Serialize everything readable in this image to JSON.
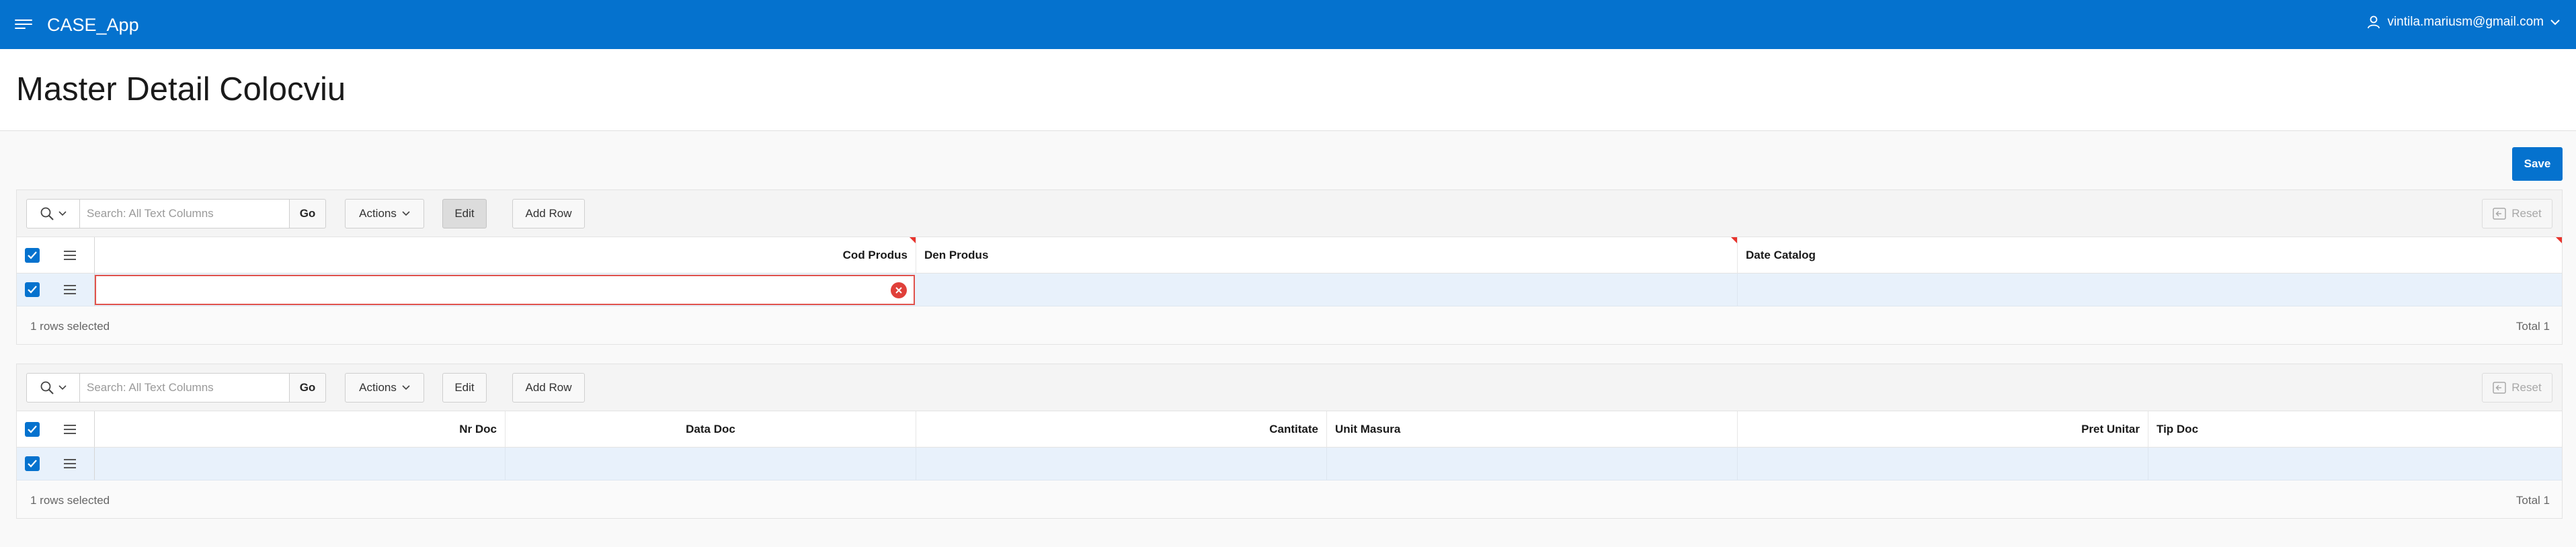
{
  "header": {
    "app_title": "CASE_App",
    "user": "vintila.mariusm@gmail.com"
  },
  "page": {
    "title": "Master Detail Colocviu",
    "save_label": "Save"
  },
  "master_grid": {
    "search_placeholder": "Search: All Text Columns",
    "go_label": "Go",
    "actions_label": "Actions",
    "edit_label": "Edit",
    "edit_mode_active": true,
    "add_row_label": "Add Row",
    "reset_label": "Reset",
    "columns": [
      "Cod Produs",
      "Den Produs",
      "Date Catalog"
    ],
    "required_columns": [
      "Cod Produs",
      "Den Produs",
      "Date Catalog"
    ],
    "rows": [
      {
        "selected": true,
        "cod_produs": "",
        "den_produs": "",
        "date_catalog": "",
        "cod_produs_error": true
      }
    ],
    "selection_text": "1 rows selected",
    "total_text": "Total 1"
  },
  "detail_grid": {
    "search_placeholder": "Search: All Text Columns",
    "go_label": "Go",
    "actions_label": "Actions",
    "edit_label": "Edit",
    "add_row_label": "Add Row",
    "reset_label": "Reset",
    "columns": [
      "Nr Doc",
      "Data Doc",
      "Cantitate",
      "Unit Masura",
      "Pret Unitar",
      "Tip Doc"
    ],
    "rows": [
      {
        "selected": true
      }
    ],
    "selection_text": "1 rows selected",
    "total_text": "Total 1"
  },
  "colors": {
    "brand": "#0572ce",
    "selected_row": "#e8f1fb",
    "error": "#e0403a"
  },
  "icons": [
    "menu-icon",
    "user-icon",
    "chevron-down-icon",
    "search-icon",
    "checkbox-checked-icon",
    "row-menu-icon",
    "error-icon",
    "reset-icon"
  ]
}
